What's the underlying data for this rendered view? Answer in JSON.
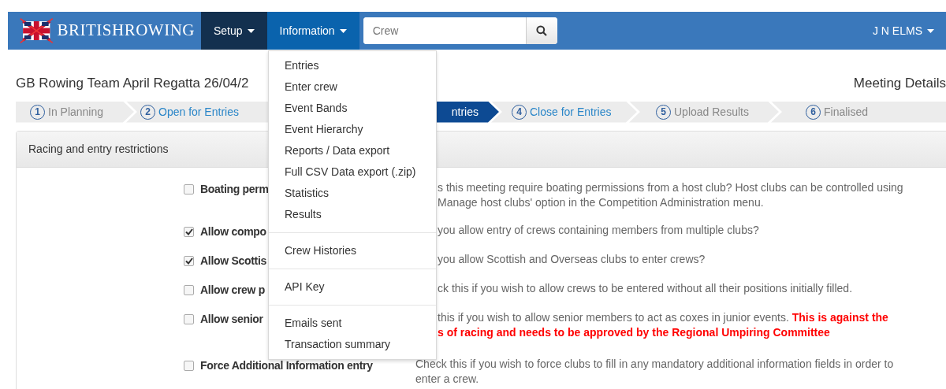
{
  "navbar": {
    "brand": "BRITISHROWING",
    "menus": [
      {
        "label": "Setup",
        "color": "#13304f"
      },
      {
        "label": "Information",
        "color": "#0a63ad"
      }
    ],
    "search": {
      "placeholder": "Crew"
    },
    "user": "J N ELMS"
  },
  "dropdown": {
    "groups": [
      [
        "Entries",
        "Enter crew",
        "Event Bands",
        "Event Hierarchy",
        "Reports / Data export",
        "Full CSV Data export (.zip)",
        "Statistics",
        "Results"
      ],
      [
        "Crew Histories"
      ],
      [
        "API Key"
      ],
      [
        "Emails sent",
        "Transaction summary"
      ]
    ]
  },
  "page": {
    "title": "GB Rowing Team April Regatta 26/04/2",
    "section": "Meeting Details"
  },
  "steps": [
    {
      "number": "1",
      "label": "In Planning",
      "kind": "plain"
    },
    {
      "number": "2",
      "label": "Open for Entries",
      "kind": "link"
    },
    {
      "label": "ntries",
      "kind": "current"
    },
    {
      "number": "4",
      "label": "Close for Entries",
      "kind": "link"
    },
    {
      "number": "5",
      "label": "Upload Results",
      "kind": "plain"
    },
    {
      "number": "6",
      "label": "Finalised",
      "kind": "plain"
    }
  ],
  "panel": {
    "title": "Racing and entry restrictions",
    "options": [
      {
        "label": "Boating perm",
        "checked": false,
        "description": "s this meeting require boating permissions from a host club? Host clubs can be controlled using Manage host clubs' option in the Competition Administration menu."
      },
      {
        "label": "Allow compo",
        "checked": true,
        "description": "you allow entry of crews containing members from multiple clubs?"
      },
      {
        "label": "Allow Scottis",
        "checked": true,
        "description": "you allow Scottish and Overseas clubs to enter crews?"
      },
      {
        "label": "Allow crew p",
        "checked": false,
        "description": "ck this if you wish to allow crews to be entered without all their positions initially filled."
      },
      {
        "label": "Allow senior",
        "checked": false,
        "description": "this if you wish to allow senior members to act as coxes in junior events.  **This is against the\ns of racing and needs to be approved by the Regional Umpiring Committee**"
      },
      {
        "label": "Force Additional Information entry",
        "checked": false,
        "description": "Check this if you wish to force clubs to fill in any mandatory additional information fields in order to enter a crew."
      }
    ]
  }
}
